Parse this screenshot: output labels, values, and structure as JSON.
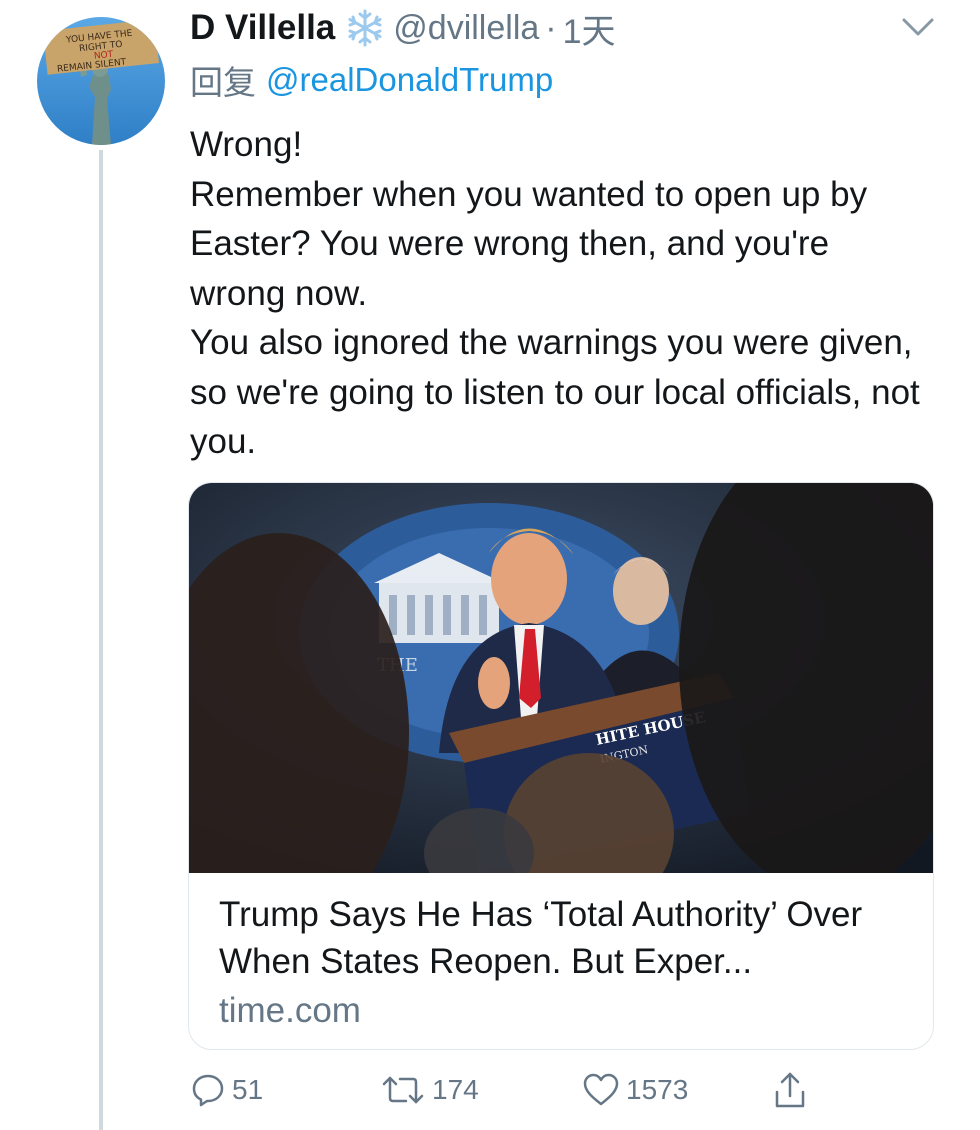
{
  "tweet": {
    "author": {
      "display_name": "D Villella",
      "badge_icon": "snowflake-icon",
      "handle": "@dvillella",
      "avatar_sign_text": [
        "YOU HAVE THE",
        "RIGHT TO",
        "NOT",
        "REMAIN SILENT"
      ]
    },
    "separator": "·",
    "time": "1天",
    "reply_prefix": "回复",
    "reply_target": "@realDonaldTrump",
    "text_lines": [
      "Wrong!",
      "Remember when you wanted to open up by Easter? You were wrong then, and you're wrong now.",
      "You also ignored the warnings you were given, so we're going to listen to our local officials, not you."
    ],
    "card": {
      "image_sign_text": [
        "THE",
        "HITE HOUSE",
        "INGTON"
      ],
      "title": "Trump Says He Has ‘Total Authority’ Over When States Reopen. But Exper...",
      "domain": "time.com"
    },
    "actions": {
      "reply_count": "51",
      "retweet_count": "174",
      "like_count": "1573"
    }
  },
  "colors": {
    "text": "#14171a",
    "secondary": "#657786",
    "link": "#1b95e0",
    "border": "#e1e8ed",
    "thread_line": "#cfd9de"
  }
}
